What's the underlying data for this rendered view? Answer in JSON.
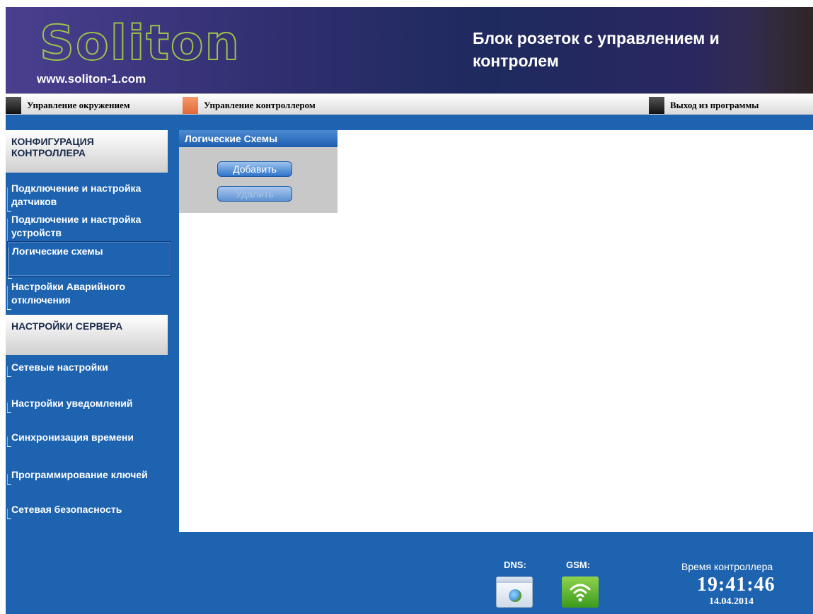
{
  "header": {
    "logo_text_a": "So",
    "logo_text_b": "liton",
    "site_url": "www.soliton-1.com",
    "title": "Блок розеток с управлением и контролем"
  },
  "menubar": {
    "items": [
      {
        "label": "Управление окружением",
        "icon": "dark-square",
        "color": "#2a2a2a"
      },
      {
        "label": "Управление контроллером",
        "icon": "orange-square",
        "color": "#ee7a4a"
      },
      {
        "label": "Выход из программы",
        "icon": "dark-square",
        "color": "#2a2a2a"
      }
    ]
  },
  "sidebar": {
    "sections": [
      {
        "title": "КОНФИГУРАЦИЯ КОНТРОЛЛЕРА",
        "items": [
          {
            "label": "Подключение и настройка датчиков"
          },
          {
            "label": "Подключение и настройка устройств"
          },
          {
            "label": "Логические схемы",
            "active": true
          },
          {
            "label": "Настройки Аварийного отключения"
          }
        ]
      },
      {
        "title": "НАСТРОЙКИ СЕРВЕРА",
        "items": [
          {
            "label": "Сетевые настройки"
          },
          {
            "label": "Настройки уведомлений"
          },
          {
            "label": "Синхронизация времени"
          },
          {
            "label": "Программирование ключей"
          },
          {
            "label": "Сетевая безопасность"
          }
        ]
      }
    ]
  },
  "panel": {
    "title": "Логические Схемы",
    "add_label": "Добавить",
    "delete_label": "Удалить"
  },
  "footer": {
    "dns_label": "DNS:",
    "gsm_label": "GSM:",
    "clock_label": "Время контроллера",
    "time": "19:41:46",
    "date": "14.04.2014"
  },
  "colors": {
    "accent_blue": "#1e63b0",
    "header_purple": "#2f2e6e"
  }
}
